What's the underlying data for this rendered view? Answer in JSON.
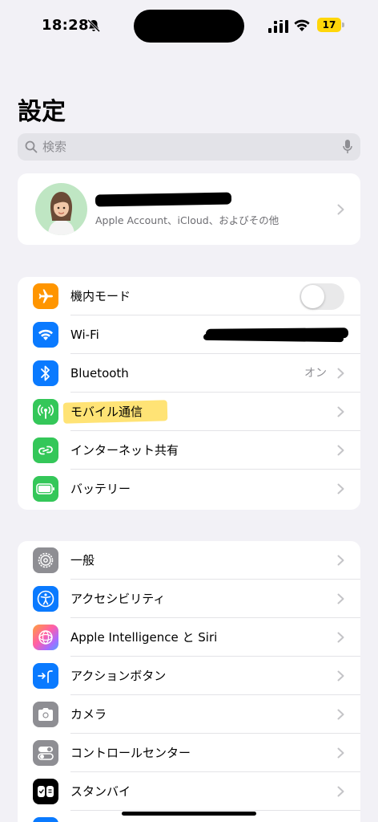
{
  "status_bar": {
    "time": "18:28",
    "battery_level": "17",
    "battery_color": "#ffd60a"
  },
  "page": {
    "title": "設定"
  },
  "search": {
    "placeholder": "検索"
  },
  "account": {
    "subtitle": "Apple Account、iCloud、およびその他"
  },
  "section1": [
    {
      "label": "機内モード",
      "icon": "airplane-icon",
      "color": "#ff9500",
      "toggle": false
    },
    {
      "label": "Wi-Fi",
      "icon": "wifi-icon",
      "color": "#0a7aff"
    },
    {
      "label": "Bluetooth",
      "icon": "bluetooth-icon",
      "color": "#0a7aff",
      "value": "オン"
    },
    {
      "label": "モバイル通信",
      "icon": "cellular-antenna-icon",
      "color": "#34c759",
      "highlighted": true
    },
    {
      "label": "インターネット共有",
      "icon": "personal-hotspot-icon",
      "color": "#34c759"
    },
    {
      "label": "バッテリー",
      "icon": "battery-icon",
      "color": "#34c759"
    }
  ],
  "section2": [
    {
      "label": "一般",
      "icon": "gear-icon",
      "color": "#8e8e93"
    },
    {
      "label": "アクセシビリティ",
      "icon": "accessibility-icon",
      "color": "#0a7aff"
    },
    {
      "label": "Apple Intelligence と Siri",
      "icon": "apple-intelligence-icon",
      "color": "#ff6fa8"
    },
    {
      "label": "アクションボタン",
      "icon": "action-button-icon",
      "color": "#0a7aff"
    },
    {
      "label": "カメラ",
      "icon": "camera-icon",
      "color": "#8e8e93"
    },
    {
      "label": "コントロールセンター",
      "icon": "control-center-icon",
      "color": "#8e8e93"
    },
    {
      "label": "スタンバイ",
      "icon": "standby-icon",
      "color": "#000000"
    }
  ]
}
